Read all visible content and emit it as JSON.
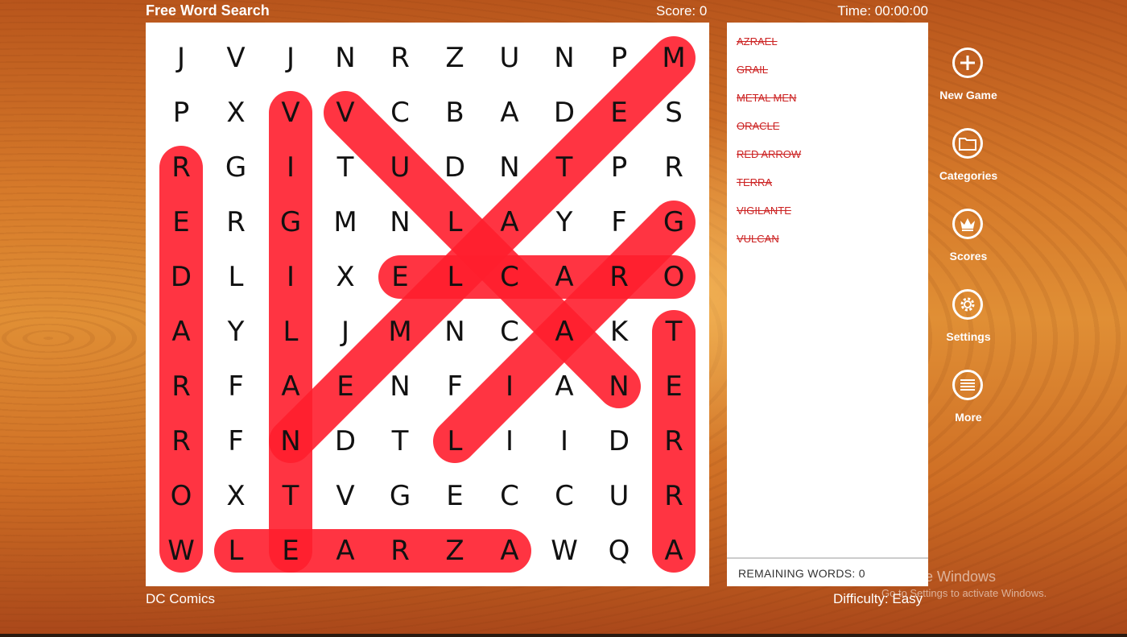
{
  "header": {
    "title": "Free Word Search",
    "score": "Score: 0",
    "time": "Time: 00:00:00"
  },
  "grid": {
    "rows": [
      [
        "J",
        "V",
        "J",
        "N",
        "R",
        "Z",
        "U",
        "N",
        "P",
        "M"
      ],
      [
        "P",
        "X",
        "V",
        "V",
        "C",
        "B",
        "A",
        "D",
        "E",
        "S"
      ],
      [
        "R",
        "G",
        "I",
        "T",
        "U",
        "D",
        "N",
        "T",
        "P",
        "R"
      ],
      [
        "E",
        "R",
        "G",
        "M",
        "N",
        "L",
        "A",
        "Y",
        "F",
        "G"
      ],
      [
        "D",
        "L",
        "I",
        "X",
        "E",
        "L",
        "C",
        "A",
        "R",
        "O"
      ],
      [
        "A",
        "Y",
        "L",
        "J",
        "M",
        "N",
        "C",
        "A",
        "K",
        "T"
      ],
      [
        "R",
        "F",
        "A",
        "E",
        "N",
        "F",
        "I",
        "A",
        "N",
        "E"
      ],
      [
        "R",
        "F",
        "N",
        "D",
        "T",
        "L",
        "I",
        "I",
        "D",
        "R"
      ],
      [
        "O",
        "X",
        "T",
        "V",
        "G",
        "E",
        "C",
        "C",
        "U",
        "R"
      ],
      [
        "W",
        "L",
        "E",
        "A",
        "R",
        "Z",
        "A",
        "W",
        "Q",
        "A"
      ]
    ]
  },
  "found_words": [
    {
      "word": "AZRAEL",
      "from": [
        9,
        6
      ],
      "to": [
        9,
        1
      ]
    },
    {
      "word": "GRAIL",
      "from": [
        3,
        9
      ],
      "to": [
        7,
        5
      ]
    },
    {
      "word": "METAL MEN",
      "from": [
        0,
        9
      ],
      "to": [
        7,
        2
      ]
    },
    {
      "word": "ORACLE",
      "from": [
        4,
        9
      ],
      "to": [
        4,
        4
      ]
    },
    {
      "word": "RED ARROW",
      "from": [
        2,
        0
      ],
      "to": [
        9,
        0
      ]
    },
    {
      "word": "TERRA",
      "from": [
        5,
        9
      ],
      "to": [
        9,
        9
      ]
    },
    {
      "word": "VIGILANTE",
      "from": [
        1,
        2
      ],
      "to": [
        9,
        2
      ]
    },
    {
      "word": "VULCAN",
      "from": [
        1,
        3
      ],
      "to": [
        6,
        8
      ]
    }
  ],
  "highlight_color": "#ff1e2d",
  "word_list": [
    "AZRAEL",
    "GRAIL",
    "METAL MEN",
    "ORACLE",
    "RED ARROW",
    "TERRA",
    "VIGILANTE",
    "VULCAN"
  ],
  "remaining_label": "REMAINING WORDS: 0",
  "menu": [
    {
      "label": "New Game",
      "icon": "plus-icon"
    },
    {
      "label": "Categories",
      "icon": "folder-icon"
    },
    {
      "label": "Scores",
      "icon": "crown-icon"
    },
    {
      "label": "Settings",
      "icon": "gear-icon"
    },
    {
      "label": "More",
      "icon": "list-icon"
    }
  ],
  "footer": {
    "category": "DC Comics",
    "difficulty": "Difficulty: Easy"
  },
  "watermark": {
    "title": "Activate Windows",
    "subtitle": "Go to Settings to activate Windows."
  }
}
